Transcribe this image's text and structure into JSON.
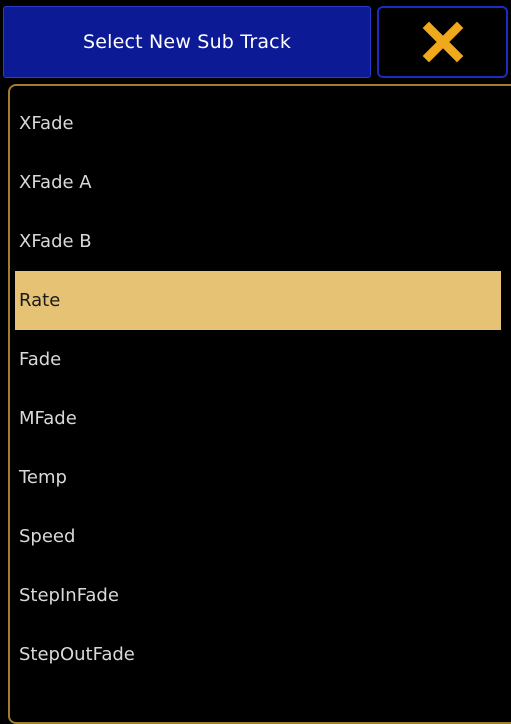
{
  "dialog": {
    "title": "Select New Sub Track",
    "close_icon": "close-icon",
    "accent_color": "#f0a81c",
    "title_bar_color": "#0d1a96",
    "selected_color": "#e6c374"
  },
  "list": {
    "items": [
      {
        "label": "XFade",
        "selected": false
      },
      {
        "label": "XFade A",
        "selected": false
      },
      {
        "label": "XFade B",
        "selected": false
      },
      {
        "label": "Rate",
        "selected": true
      },
      {
        "label": "Fade",
        "selected": false
      },
      {
        "label": "MFade",
        "selected": false
      },
      {
        "label": "Temp",
        "selected": false
      },
      {
        "label": "Speed",
        "selected": false
      },
      {
        "label": "StepInFade",
        "selected": false
      },
      {
        "label": "StepOutFade",
        "selected": false
      }
    ]
  }
}
